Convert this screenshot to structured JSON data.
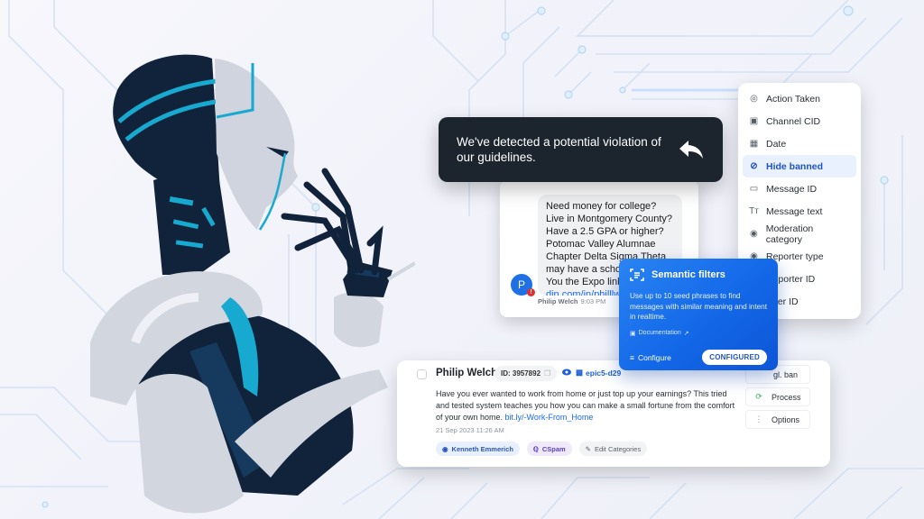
{
  "toast": {
    "message": "We've detected a potential violation of our guidelines.",
    "icon": "reply-arrow-icon"
  },
  "chat": {
    "message_text": "Need money for college? Live in Montgomery County? Have a 2.5 GPA or higher? Potomac Valley Alumnae Chapter Delta Sigma Theta may have a scholarship for You",
    "message_tail": "the Expo link. ",
    "link_partial_1": "https",
    "link_partial_2": "din.com/in/philllw",
    "avatar_initial": "P",
    "alert_glyph": "!",
    "sender": "Philip Welch",
    "time": "9:03 PM"
  },
  "filter_menu": {
    "items": [
      {
        "label": "Action Taken",
        "icon": "action-taken-icon",
        "glyph": "◎"
      },
      {
        "label": "Channel CID",
        "icon": "channel-icon",
        "glyph": "▣"
      },
      {
        "label": "Date",
        "icon": "calendar-icon",
        "glyph": "▦"
      },
      {
        "label": "Hide banned",
        "icon": "eye-off-icon",
        "glyph": "⊘",
        "active": true
      },
      {
        "label": "Message ID",
        "icon": "message-icon",
        "glyph": "▭"
      },
      {
        "label": "Message text",
        "icon": "text-icon",
        "glyph": "Tт"
      },
      {
        "label": "Moderation category",
        "icon": "category-icon",
        "glyph": "◉"
      },
      {
        "label": "Reporter type",
        "icon": "reporter-type-icon",
        "glyph": "◉"
      },
      {
        "label": "Reporter ID",
        "icon": "reporter-id-icon",
        "glyph": "◉"
      },
      {
        "label": "User ID",
        "icon": "user-id-icon",
        "glyph": "◉"
      }
    ]
  },
  "semantic": {
    "title": "Semantic filters",
    "description": "Use up to 10 seed phrases to find messages with similar meaning and intent in realtime.",
    "doc_link": "Documentation",
    "configure_label": "Configure",
    "status_label": "CONFIGURED"
  },
  "moderation": {
    "user_name": "Philip Welch",
    "id_label": "ID: 3957892",
    "channel_label": "epic5-d29",
    "text": "Have you ever wanted to work from home or just top up your earnings? This tried and tested system teaches you how you can make a small fortune from the comfort of your own home. ",
    "link": "bit.ly/-Work-From_Home",
    "date": "21 Sep 2023 11:26 AM",
    "tags": {
      "user": "Kenneth Emmerich",
      "category": "CSpam",
      "edit": "Edit Categories"
    },
    "actions": [
      {
        "label": "Gl. ban",
        "visible_label": "gl. ban",
        "icon": "ban-icon"
      },
      {
        "label": "Process",
        "icon": "process-icon"
      },
      {
        "label": "Options",
        "icon": "options-icon"
      }
    ]
  },
  "colors": {
    "accent_blue": "#1368e8",
    "dark": "#1c252e",
    "robot_cyan": "#17a9cf",
    "robot_navy": "#10233a"
  }
}
